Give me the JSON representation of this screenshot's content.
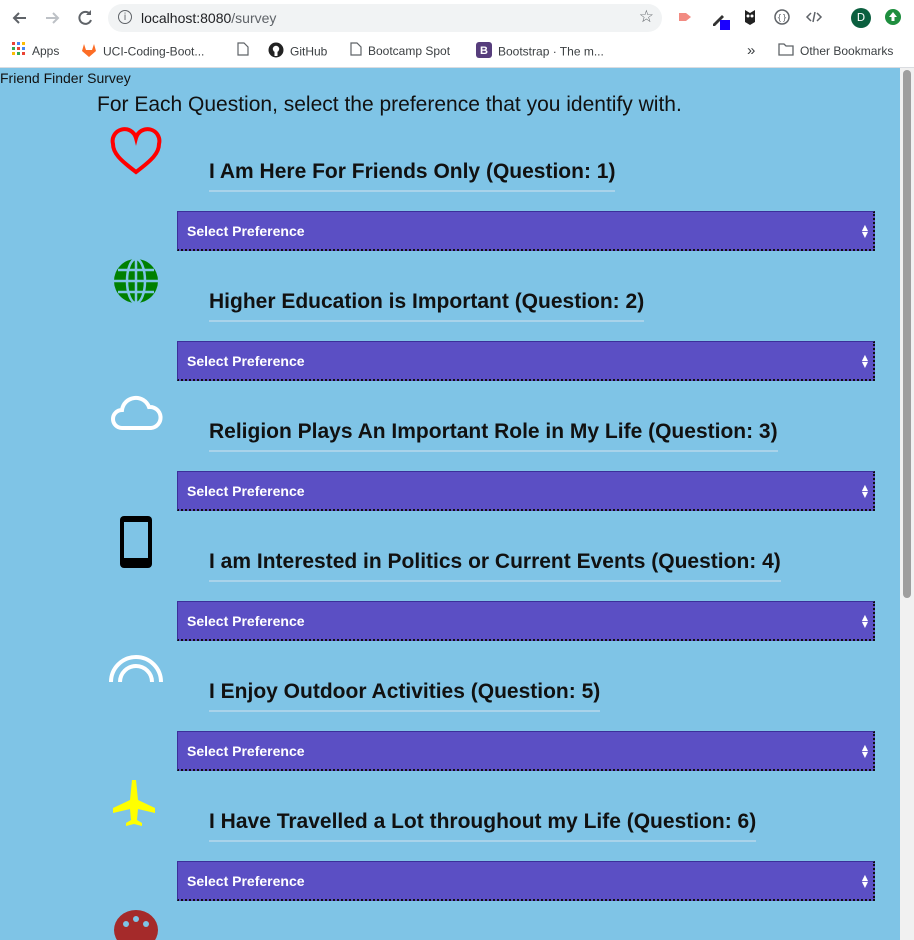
{
  "browser": {
    "url_host": "localhost:8080",
    "url_path": "/survey",
    "avatar_letter": "D",
    "bookmarks": [
      {
        "label": "Apps",
        "icon": "apps-grid-icon"
      },
      {
        "label": "UCI-Coding-Boot...",
        "icon": "gitlab-icon"
      },
      {
        "label": "",
        "icon": "page-icon"
      },
      {
        "label": "GitHub",
        "icon": "github-icon"
      },
      {
        "label": "Bootcamp Spot",
        "icon": "page-icon"
      },
      {
        "label": "Bootstrap · The m...",
        "icon": "bootstrap-icon"
      }
    ],
    "overflow": "»",
    "other_bookmarks": "Other Bookmarks"
  },
  "page": {
    "app_title": "Friend Finder Survey",
    "heading": "For Each Question, select the preference that you identify with."
  },
  "questions": [
    {
      "title": "I Am Here For Friends Only (Question: 1)",
      "icon": "heart-icon",
      "icon_color": "#ff0000",
      "select_value": "Select Preference"
    },
    {
      "title": "Higher Education is Important (Question: 2)",
      "icon": "globe-icon",
      "icon_color": "#008000",
      "select_value": "Select Preference"
    },
    {
      "title": "Religion Plays An Important Role in My Life (Question: 3)",
      "icon": "cloud-icon",
      "icon_color": "#ffffff",
      "select_value": "Select Preference"
    },
    {
      "title": "I am Interested in Politics or Current Events (Question: 4)",
      "icon": "mobile-phone-icon",
      "icon_color": "#000000",
      "select_value": "Select Preference"
    },
    {
      "title": "I Enjoy Outdoor Activities (Question: 5)",
      "icon": "rainbow-icon",
      "icon_color": "#ffffff",
      "select_value": "Select Preference"
    },
    {
      "title": "I Have Travelled a Lot throughout my Life (Question: 6)",
      "icon": "plane-icon",
      "icon_color": "#ffff00",
      "select_value": "Select Preference"
    },
    {
      "title": "",
      "icon": "palette-icon",
      "icon_color": "#a52a2a",
      "select_value": ""
    }
  ],
  "colors": {
    "page_background": "#7fc4e6",
    "select_background": "#5b4fc4"
  }
}
